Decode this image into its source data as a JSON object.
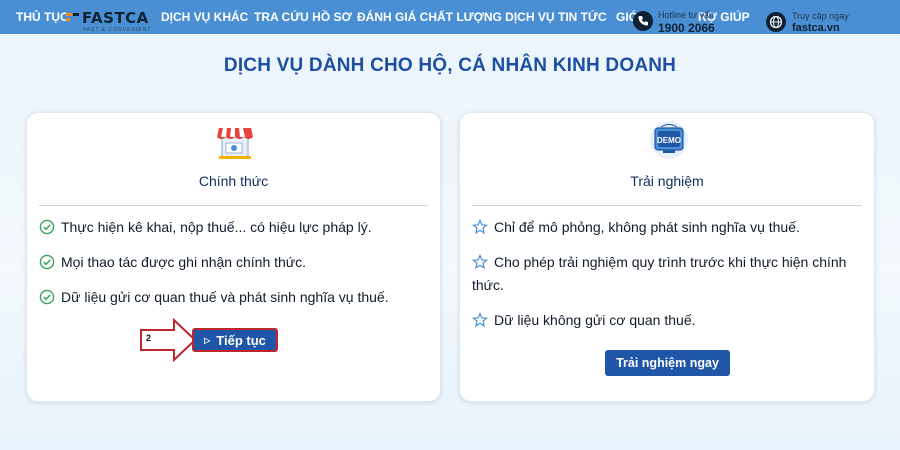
{
  "nav": {
    "items": [
      "THỦ TỤC",
      "DỊCH VỤ KHÁC",
      "TRA CỨU HỒ SƠ",
      "ĐÁNH GIÁ CHẤT LƯỢNG DỊCH VỤ",
      "TIN TỨC",
      "GIỚ",
      "RỢ GIÚP"
    ]
  },
  "logo": {
    "name": "FASTCA",
    "tagline": "FAST & CONVENIENT"
  },
  "hotline": {
    "label": "Hotline tư vấn",
    "number": "1900 2066",
    "icon": "phone-icon"
  },
  "access": {
    "label": "Truy cập ngay",
    "site": "fastca.vn",
    "icon": "globe-icon"
  },
  "page": {
    "title": "DỊCH VỤ DÀNH CHO HỘ, CÁ NHÂN KINH DOANH"
  },
  "official": {
    "title": "Chính thức",
    "icon": "store-icon",
    "features": [
      "Thực hiện kê khai, nộp thuế... có hiệu lực pháp lý.",
      "Mọi thao tác được ghi nhận chính thức.",
      "Dữ liệu gửi cơ quan thuế và phát sinh nghĩa vụ thuế."
    ],
    "step_number": "2",
    "button_label": "Tiếp tục"
  },
  "trial": {
    "title": "Trải nghiệm",
    "icon": "demo-icon",
    "icon_text": "DEMO",
    "features": [
      "Chỉ để mô phỏng, không phát sinh nghĩa vụ thuế.",
      "Cho phép trải nghiệm quy trình trước khi thực hiện chính thức.",
      "Dữ liệu không gửi cơ quan thuế."
    ],
    "button_label": "Trải nghiệm ngay"
  },
  "colors": {
    "nav_bg": "#4a8fd4",
    "title": "#1d4fa3",
    "button": "#1f56a8",
    "highlight": "#c0272d",
    "check": "#3aa35b"
  }
}
